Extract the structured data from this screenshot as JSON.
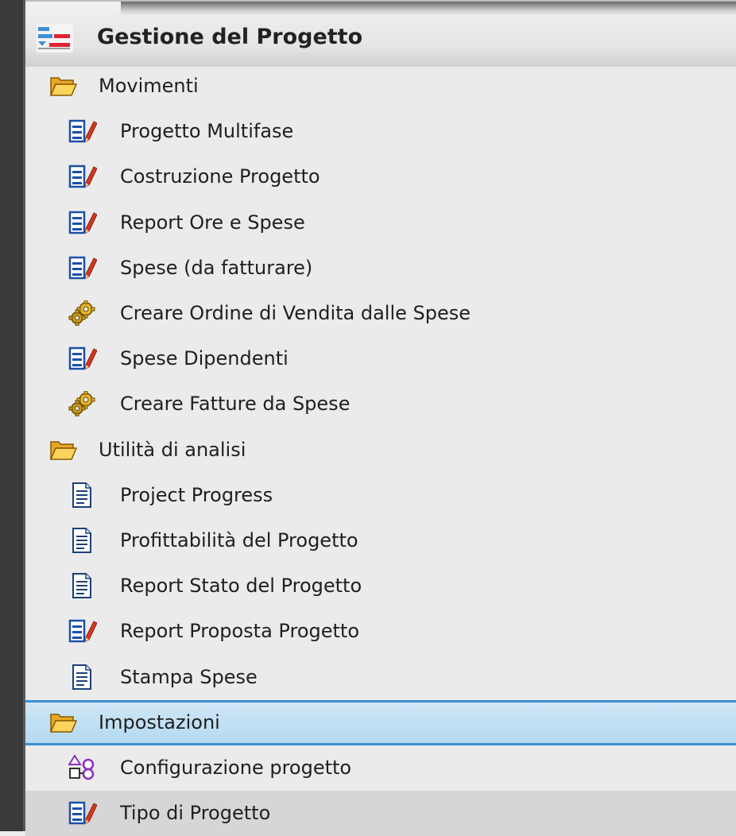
{
  "header": {
    "title": "Gestione del Progetto",
    "icon": "project-management-icon"
  },
  "tree": [
    {
      "type": "folder",
      "label": "Movimenti",
      "icon": "folder-open-icon"
    },
    {
      "type": "item",
      "label": "Progetto Multifase",
      "icon": "form-edit-icon"
    },
    {
      "type": "item",
      "label": "Costruzione Progetto",
      "icon": "form-edit-icon"
    },
    {
      "type": "item",
      "label": "Report Ore e Spese",
      "icon": "form-edit-icon"
    },
    {
      "type": "item",
      "label": "Spese (da fatturare)",
      "icon": "form-edit-icon"
    },
    {
      "type": "item",
      "label": "Creare Ordine di Vendita dalle Spese",
      "icon": "gears-icon"
    },
    {
      "type": "item",
      "label": "Spese Dipendenti",
      "icon": "form-edit-icon"
    },
    {
      "type": "item",
      "label": "Creare Fatture da Spese",
      "icon": "gears-icon"
    },
    {
      "type": "folder",
      "label": "Utilità di analisi",
      "icon": "folder-open-icon"
    },
    {
      "type": "item",
      "label": "Project Progress",
      "icon": "report-document-icon"
    },
    {
      "type": "item",
      "label": "Profittabilità del Progetto",
      "icon": "report-document-icon"
    },
    {
      "type": "item",
      "label": "Report Stato del Progetto",
      "icon": "report-document-icon"
    },
    {
      "type": "item",
      "label": "Report Proposta Progetto",
      "icon": "form-edit-icon"
    },
    {
      "type": "item",
      "label": "Stampa Spese",
      "icon": "report-document-icon"
    },
    {
      "type": "folder",
      "label": "Impostazioni",
      "icon": "folder-open-icon",
      "state": "selected"
    },
    {
      "type": "item",
      "label": "Configurazione progetto",
      "icon": "configuration-shapes-icon"
    },
    {
      "type": "item",
      "label": "Tipo di Progetto",
      "icon": "form-edit-icon",
      "state": "hover"
    }
  ],
  "colors": {
    "background": "#ebebeb",
    "selected_background": "#b4daf2",
    "selected_border": "#3d8fd0",
    "hover_background": "#d6d6d6",
    "folder_yellow": "#f7c948",
    "form_icon_blue": "#1c4fa8",
    "form_icon_red": "#d23a1f"
  }
}
